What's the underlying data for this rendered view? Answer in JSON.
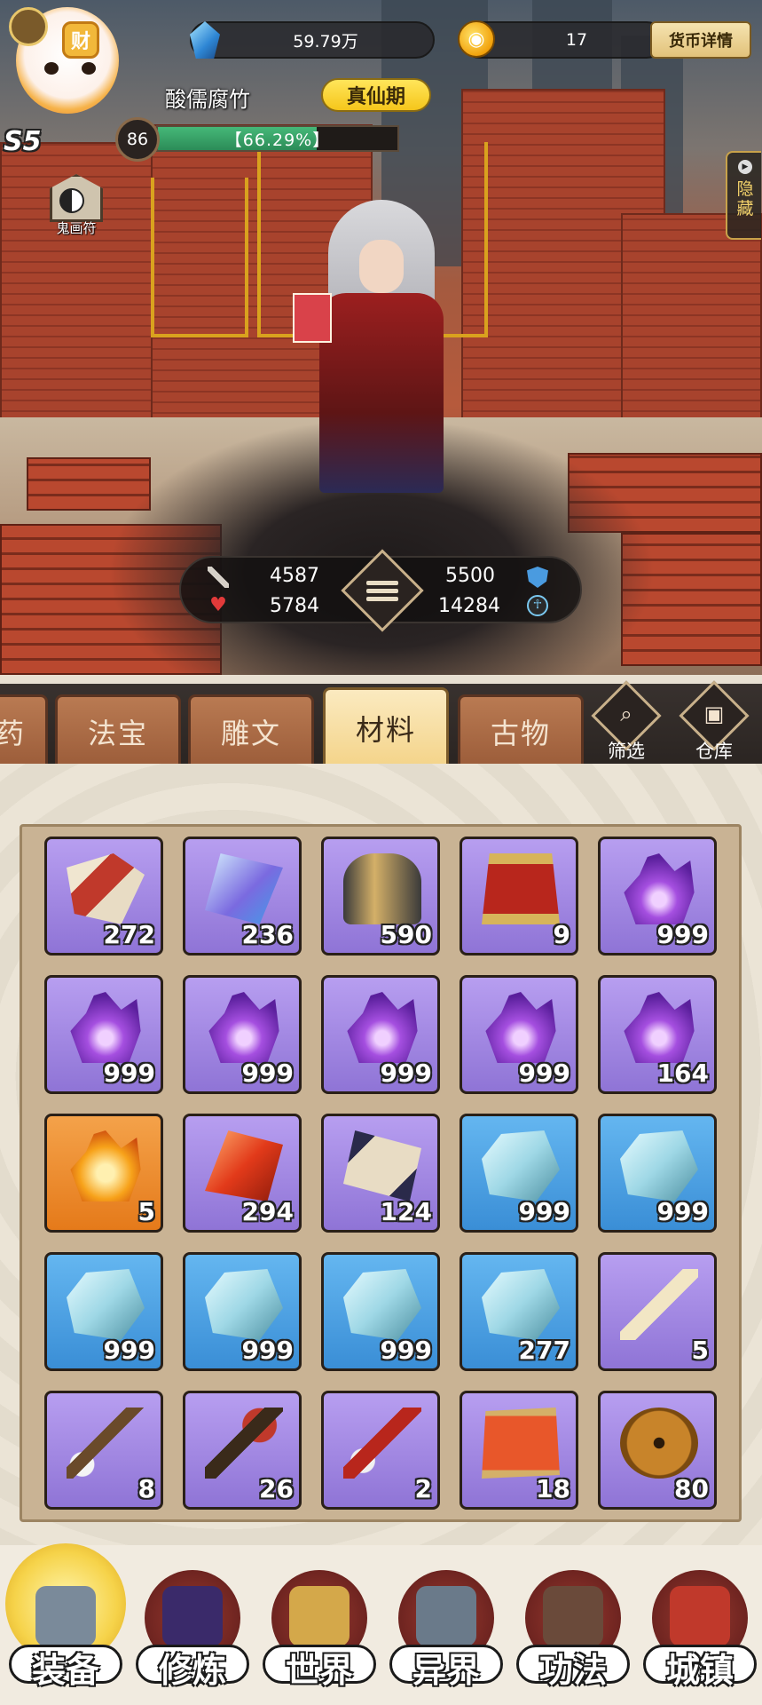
{
  "header": {
    "avatar_badge": "财",
    "server_label": "S5",
    "player_name": "酸儒腐竹",
    "realm": "真仙期",
    "level": "86",
    "exp_progress": 0.6629,
    "exp_text": "【66.29%】",
    "jade_amount": "59.79万",
    "gold_amount": "17",
    "currency_detail_label": "货币详情",
    "talisman_label": "鬼画符",
    "hide_label": "隐藏"
  },
  "stats": {
    "attack": "4587",
    "defense": "5500",
    "hp": "5784",
    "spirit": "14284"
  },
  "tabs": [
    {
      "label": "药",
      "active": false
    },
    {
      "label": "法宝",
      "active": false
    },
    {
      "label": "雕文",
      "active": false
    },
    {
      "label": "材料",
      "active": true
    },
    {
      "label": "古物",
      "active": false
    }
  ],
  "tools": {
    "filter_label": "筛选",
    "storage_label": "仓库"
  },
  "inventory": [
    {
      "icon": "scroll-bundle-icon",
      "count": "272",
      "rarity": "purple"
    },
    {
      "icon": "crystal-shard-icon",
      "count": "236",
      "rarity": "purple"
    },
    {
      "icon": "drum-icon",
      "count": "590",
      "rarity": "purple"
    },
    {
      "icon": "banner-scroll-icon",
      "count": "9",
      "rarity": "purple"
    },
    {
      "icon": "purple-flame-icon",
      "count": "999",
      "rarity": "purple"
    },
    {
      "icon": "purple-flame-icon",
      "count": "999",
      "rarity": "purple"
    },
    {
      "icon": "purple-flame-icon",
      "count": "999",
      "rarity": "purple"
    },
    {
      "icon": "purple-flame-icon",
      "count": "999",
      "rarity": "purple"
    },
    {
      "icon": "purple-flame-icon",
      "count": "999",
      "rarity": "purple"
    },
    {
      "icon": "purple-flame-icon",
      "count": "164",
      "rarity": "purple"
    },
    {
      "icon": "orange-flame-icon",
      "count": "5",
      "rarity": "orange"
    },
    {
      "icon": "red-crystal-icon",
      "count": "294",
      "rarity": "purple"
    },
    {
      "icon": "refresh-card-icon",
      "count": "124",
      "rarity": "purple"
    },
    {
      "icon": "spirit-stone-icon",
      "count": "999",
      "rarity": "blue"
    },
    {
      "icon": "spirit-stone-icon",
      "count": "999",
      "rarity": "blue"
    },
    {
      "icon": "spirit-stone-icon",
      "count": "999",
      "rarity": "blue"
    },
    {
      "icon": "spirit-stone-icon",
      "count": "999",
      "rarity": "blue"
    },
    {
      "icon": "spirit-stone-icon",
      "count": "999",
      "rarity": "blue"
    },
    {
      "icon": "spirit-stone-icon",
      "count": "277",
      "rarity": "blue"
    },
    {
      "icon": "ornate-sword-icon",
      "count": "5",
      "rarity": "purple"
    },
    {
      "icon": "calligraphy-brush-icon",
      "count": "8",
      "rarity": "purple"
    },
    {
      "icon": "tassel-key-icon",
      "count": "26",
      "rarity": "purple"
    },
    {
      "icon": "red-brush-icon",
      "count": "2",
      "rarity": "purple"
    },
    {
      "icon": "map-scroll-icon",
      "count": "18",
      "rarity": "purple"
    },
    {
      "icon": "ancient-coin-icon",
      "count": "80",
      "rarity": "purple"
    }
  ],
  "nav": [
    {
      "label": "装备",
      "icon": "equipment-icon",
      "active": true
    },
    {
      "label": "修炼",
      "icon": "cultivation-icon",
      "active": false
    },
    {
      "label": "世界",
      "icon": "world-icon",
      "active": false
    },
    {
      "label": "异界",
      "icon": "otherworld-icon",
      "active": false
    },
    {
      "label": "功法",
      "icon": "techniques-icon",
      "active": false
    },
    {
      "label": "城镇",
      "icon": "town-icon",
      "active": false
    }
  ]
}
